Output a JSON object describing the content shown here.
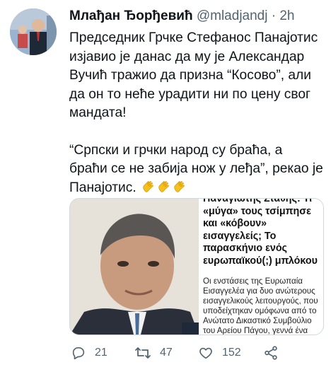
{
  "tweet": {
    "author_name": "Млађан Ђорђевић",
    "author_handle": "@mladjandj",
    "separator": "·",
    "time": "2h",
    "paragraph1": "Председник Грчке Стефанос Панајотис изјавио је данас да му је Александар Вучић тражио да призна “Косово”, али да он то неће урадити ни по цену свог мандата!",
    "paragraph2": "“Српски и грчки народ су браћа, а браћи се не забија нож у леђа”, рекао је Панајотис.",
    "emojis": [
      "clapping-hands",
      "clapping-hands",
      "clapping-hands"
    ]
  },
  "card": {
    "headline": "Παναγιώτης Σταθης: Τι «μύγα» τους τσίμπησε και «κόβουν» εισαγγελείς; Το παρασκήνιο ενός ευρωπαϊκού(;) μπλόκου",
    "body": "Οι ενστάσεις της Ευρωπαία Εισαγγελέα για δυο ανώτερους εισαγγελικούς λειτουργούς, που υποδείχτηκαν ομόφωνα  από το Ανώτατο Δικαστικό Συμβούλιο του Αρείου Πάγου, γεννά ένα ερώτημα: Ποιος τους ενημέρωσε «αρνητικά» για αυτούς;"
  },
  "actions": {
    "reply_count": "21",
    "retweet_count": "47",
    "like_count": "152"
  },
  "colors": {
    "text": "#0f1419",
    "muted": "#536471",
    "border": "#cfd9de"
  }
}
